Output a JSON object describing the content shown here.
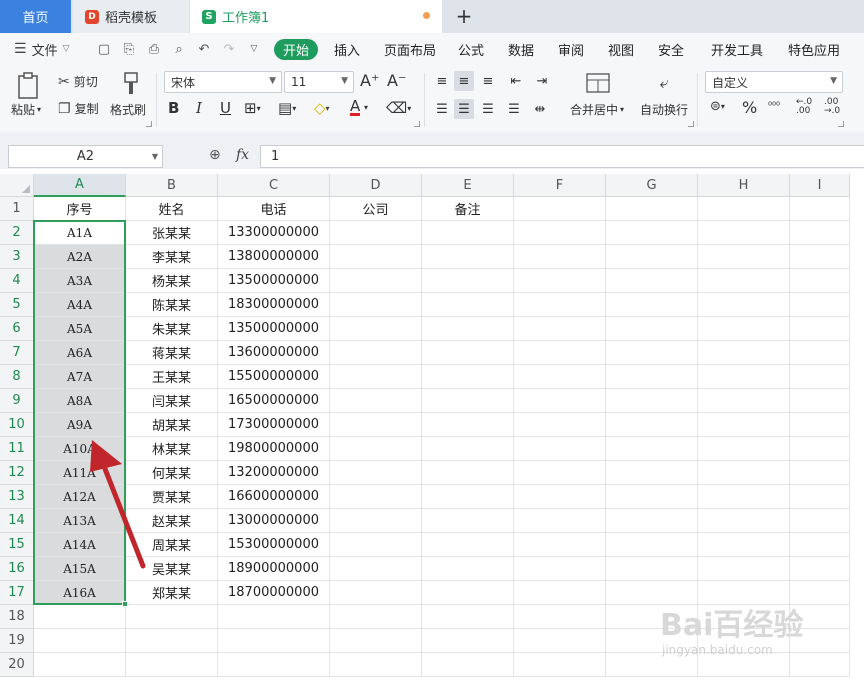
{
  "tabs": {
    "home": "首页",
    "templates": "稻壳模板",
    "workbook": "工作簿1",
    "add": "+"
  },
  "menu": {
    "file": "文件",
    "items": [
      "开始",
      "插入",
      "页面布局",
      "公式",
      "数据",
      "审阅",
      "视图",
      "安全",
      "开发工具",
      "特色应用"
    ]
  },
  "ribbon": {
    "paste": "粘贴",
    "cut": "剪切",
    "copy": "复制",
    "format_painter": "格式刷",
    "font_name": "宋体",
    "font_size": "11",
    "bold": "B",
    "italic": "I",
    "underline": "U",
    "merge_center": "合并居中",
    "wrap_text": "自动换行",
    "number_format": "自定义",
    "currency": "¥",
    "percent": "%"
  },
  "formula_bar": {
    "name_box": "A2",
    "fx": "fx",
    "value": "1"
  },
  "grid": {
    "columns": [
      "A",
      "B",
      "C",
      "D",
      "E",
      "F",
      "G",
      "H",
      "I"
    ],
    "rows": [
      "1",
      "2",
      "3",
      "4",
      "5",
      "6",
      "7",
      "8",
      "9",
      "10",
      "11",
      "12",
      "13",
      "14",
      "15",
      "16",
      "17",
      "18",
      "19",
      "20"
    ],
    "headers": [
      "序号",
      "姓名",
      "电话",
      "公司",
      "备注"
    ],
    "data": [
      [
        "A1A",
        "张某某",
        "13300000000"
      ],
      [
        "A2A",
        "李某某",
        "13800000000"
      ],
      [
        "A3A",
        "杨某某",
        "13500000000"
      ],
      [
        "A4A",
        "陈某某",
        "18300000000"
      ],
      [
        "A5A",
        "朱某某",
        "13500000000"
      ],
      [
        "A6A",
        "蒋某某",
        "13600000000"
      ],
      [
        "A7A",
        "王某某",
        "15500000000"
      ],
      [
        "A8A",
        "闫某某",
        "16500000000"
      ],
      [
        "A9A",
        "胡某某",
        "17300000000"
      ],
      [
        "A10A",
        "林某某",
        "19800000000"
      ],
      [
        "A11A",
        "何某某",
        "13200000000"
      ],
      [
        "A12A",
        "贾某某",
        "16600000000"
      ],
      [
        "A13A",
        "赵某某",
        "13000000000"
      ],
      [
        "A14A",
        "周某某",
        "15300000000"
      ],
      [
        "A15A",
        "吴某某",
        "18900000000"
      ],
      [
        "A16A",
        "郑某某",
        "18700000000"
      ]
    ]
  },
  "watermark": {
    "brand": "Bai百经验",
    "url": "jingyan.baidu.com"
  },
  "colors": {
    "accent": "#1e9c5e",
    "selection": "#2f9e5b",
    "arrow": "#c0262b"
  }
}
